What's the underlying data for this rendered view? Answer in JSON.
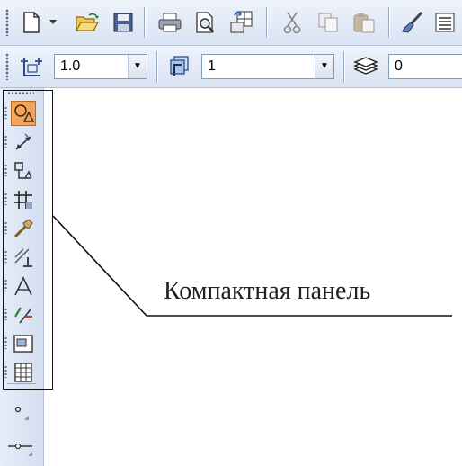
{
  "toolbar_main": {
    "buttons": [
      {
        "name": "new-document-icon"
      },
      {
        "name": "dropdown-arrow-icon"
      },
      {
        "name": "open-folder-icon"
      },
      {
        "name": "save-icon"
      },
      {
        "name": "print-icon"
      },
      {
        "name": "print-preview-icon"
      },
      {
        "name": "manager-icon"
      },
      {
        "name": "cut-icon"
      },
      {
        "name": "copy-icon"
      },
      {
        "name": "paste-icon"
      },
      {
        "name": "format-brush-icon"
      },
      {
        "name": "properties-icon"
      }
    ]
  },
  "toolbar_format": {
    "scale_value": "1.0",
    "step_value": "1",
    "layer_value": "0"
  },
  "compact_panel": {
    "tools": [
      {
        "name": "geometry-icon",
        "active": true
      },
      {
        "name": "dimensions-icon",
        "active": false
      },
      {
        "name": "symbols-icon",
        "active": false
      },
      {
        "name": "editing-icon",
        "active": false
      },
      {
        "name": "parametrization-icon",
        "active": false
      },
      {
        "name": "measurement-icon",
        "active": false
      },
      {
        "name": "selection-icon",
        "active": false
      },
      {
        "name": "construction-icon",
        "active": false
      },
      {
        "name": "view-icon",
        "active": false
      },
      {
        "name": "table-icon",
        "active": false
      }
    ],
    "extra_tools": [
      {
        "name": "point-icon"
      },
      {
        "name": "segment-icon"
      }
    ]
  },
  "annotation": {
    "label": "Компактная панель"
  },
  "colors": {
    "toolbar_bg": "#dde6f4",
    "active_tool": "#f5a35a",
    "frame": "#111111"
  }
}
